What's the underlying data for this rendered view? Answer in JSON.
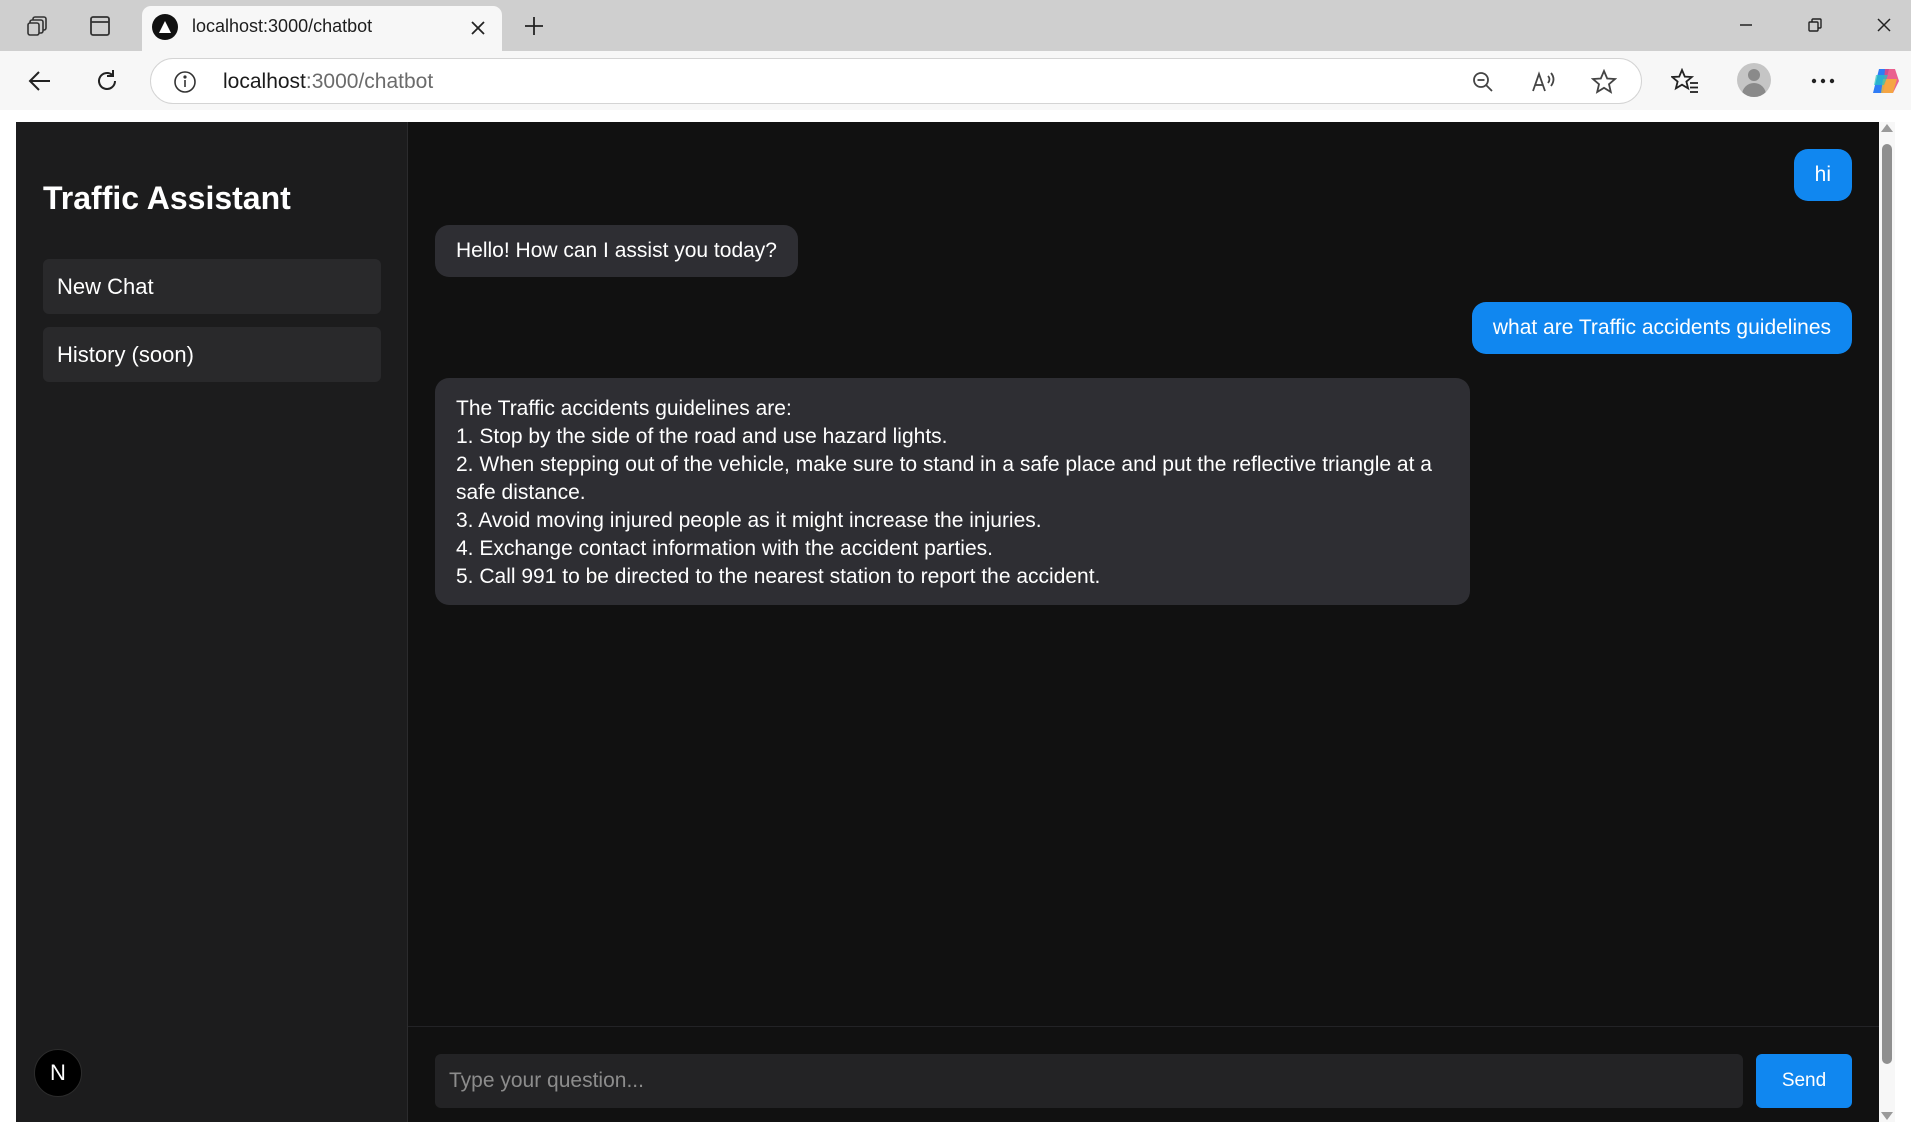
{
  "browser": {
    "tab": {
      "title": "localhost:3000/chatbot",
      "favicon": "nextjs-triangle-icon"
    },
    "address_bar": {
      "host": "localhost",
      "path": ":3000/chatbot"
    },
    "icons": {
      "workspaces": "workspaces-icon",
      "vertical_tabs": "tab-layout-icon",
      "close_tab": "close-icon",
      "new_tab": "plus-icon",
      "minimize": "minimize-icon",
      "restore": "restore-icon",
      "close_window": "close-icon",
      "back": "back-arrow-icon",
      "refresh": "refresh-icon",
      "site_info": "info-icon",
      "zoom": "zoom-out-icon",
      "read_aloud": "read-aloud-icon",
      "favorite": "star-icon",
      "favorites": "favorites-icon",
      "profile": "profile-icon",
      "more": "more-icon",
      "copilot": "copilot-icon"
    }
  },
  "sidebar": {
    "title": "Traffic Assistant",
    "items": [
      {
        "label": "New Chat"
      },
      {
        "label": "History (soon)"
      }
    ],
    "badge": "N"
  },
  "chat": {
    "messages": [
      {
        "role": "user",
        "text": "hi"
      },
      {
        "role": "assistant",
        "text": "Hello! How can I assist you today?"
      },
      {
        "role": "user",
        "text": "what are Traffic accidents guidelines"
      },
      {
        "role": "assistant",
        "lines": [
          "The Traffic accidents guidelines are:",
          "1. Stop by the side of the road and use hazard lights.",
          "2. When stepping out of the vehicle, make sure to stand in a safe place and put the reflective triangle at a safe distance.",
          "3. Avoid moving injured people as it might increase the injuries.",
          "4. Exchange contact information with the accident parties.",
          "5. Call 991 to be directed to the nearest station to report the accident."
        ]
      }
    ],
    "input": {
      "placeholder": "Type your question...",
      "value": ""
    },
    "send_label": "Send"
  },
  "colors": {
    "accent": "#1087f0",
    "page_background": "#111111",
    "sidebar_background": "#1c1c1d",
    "assistant_bubble": "#2e2e33"
  }
}
